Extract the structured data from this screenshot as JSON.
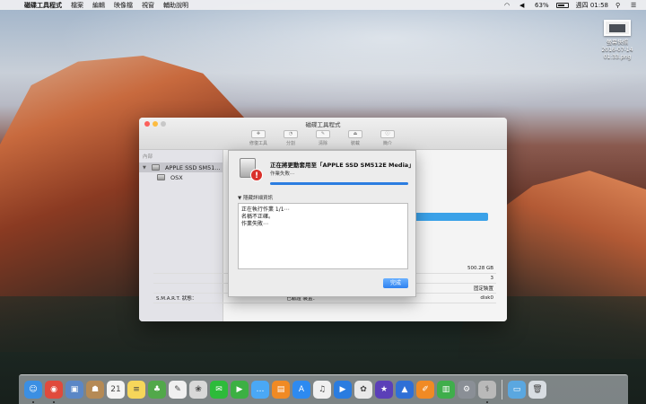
{
  "menubar": {
    "app_name": "磁碟工具程式",
    "items": [
      "檔案",
      "編輯",
      "映像檔",
      "視窗",
      "輔助說明"
    ],
    "battery": "63%",
    "clock": "週四 01:58"
  },
  "desktop_file": {
    "name_line1": "螢幕快照",
    "name_line2": "2016-07-14 01:33.png"
  },
  "window": {
    "title": "磁碟工具程式",
    "toolbar": [
      {
        "label": "修復工具",
        "icon": "stethoscope-icon",
        "glyph": "✚"
      },
      {
        "label": "分割",
        "icon": "partition-icon",
        "glyph": "◔"
      },
      {
        "label": "清除",
        "icon": "erase-icon",
        "glyph": "✎"
      },
      {
        "label": "裝載",
        "icon": "mount-icon",
        "glyph": "⏏"
      },
      {
        "label": "簡介",
        "icon": "info-icon",
        "glyph": "ⓘ"
      }
    ],
    "sidebar": {
      "section": "內部",
      "disk": "APPLE SSD SM51...",
      "volume": "OSX"
    },
    "info_rows": [
      {
        "left": "",
        "mid": "",
        "value": "500.28 GB"
      },
      {
        "left": "",
        "mid": "",
        "value": "3"
      },
      {
        "left": "",
        "mid": "",
        "value": "固定裝置"
      },
      {
        "left": "S.M.A.R.T. 狀態：",
        "mid": "已驗證  裝置：",
        "value": "disk0"
      }
    ]
  },
  "sheet": {
    "title": "正在將更動套用至「APPLE SSD SM512E Media」",
    "subtitle": "作業失敗⋯",
    "progress": 1.0,
    "details_label": "隱藏詳細資訊",
    "log": [
      "正在執行作業 1/1⋯",
      "名稱不正確。",
      "作業失敗⋯"
    ],
    "done_label": "完成"
  },
  "dock": [
    {
      "name": "finder-icon",
      "color": "#3b8fe3",
      "glyph": "☺",
      "running": true
    },
    {
      "name": "chrome-icon",
      "color": "#e04a3c",
      "glyph": "◉",
      "running": true
    },
    {
      "name": "preview-icon",
      "color": "#5b87c6",
      "glyph": "▣",
      "running": false
    },
    {
      "name": "contacts-icon",
      "color": "#b58a55",
      "glyph": "☗",
      "running": false
    },
    {
      "name": "calendar-icon",
      "color": "#f4f4f4",
      "glyph": "21",
      "running": false
    },
    {
      "name": "notes-icon",
      "color": "#f6d65a",
      "glyph": "≡",
      "running": false
    },
    {
      "name": "evernote-icon",
      "color": "#52a84a",
      "glyph": "♣",
      "running": false
    },
    {
      "name": "textedit-icon",
      "color": "#f0f0f0",
      "glyph": "✎",
      "running": false
    },
    {
      "name": "photos-icon",
      "color": "#d8d8d8",
      "glyph": "❀",
      "running": false
    },
    {
      "name": "line-icon",
      "color": "#2dbb3a",
      "glyph": "✉",
      "running": false
    },
    {
      "name": "facetime-icon",
      "color": "#3cb043",
      "glyph": "▶",
      "running": false
    },
    {
      "name": "messages-icon",
      "color": "#4aa8f5",
      "glyph": "…",
      "running": false
    },
    {
      "name": "ibooks-icon",
      "color": "#f08a24",
      "glyph": "▤",
      "running": false
    },
    {
      "name": "app-store-icon",
      "color": "#2d8af0",
      "glyph": "A",
      "running": false
    },
    {
      "name": "itunes-icon",
      "color": "#f0f0f0",
      "glyph": "♫",
      "running": false
    },
    {
      "name": "quicktime-icon",
      "color": "#2a7ce0",
      "glyph": "▶",
      "running": false
    },
    {
      "name": "picasa-icon",
      "color": "#e9e9e9",
      "glyph": "✿",
      "running": false
    },
    {
      "name": "imovie-icon",
      "color": "#5b3fb8",
      "glyph": "★",
      "running": false
    },
    {
      "name": "keynote-icon",
      "color": "#2f6fd6",
      "glyph": "▲",
      "running": false
    },
    {
      "name": "pages-icon",
      "color": "#f08a24",
      "glyph": "✐",
      "running": false
    },
    {
      "name": "numbers-icon",
      "color": "#3fae4b",
      "glyph": "▥",
      "running": false
    },
    {
      "name": "system-preferences-icon",
      "color": "#8a8f96",
      "glyph": "⚙",
      "running": false
    },
    {
      "name": "disk-utility-icon",
      "color": "#b9b9b9",
      "glyph": "⚕",
      "running": true
    }
  ],
  "dock_right": [
    {
      "name": "downloads-folder-icon",
      "color": "#5aa7e0",
      "glyph": "▭"
    },
    {
      "name": "trash-icon",
      "color": "#d8dde2",
      "glyph": "🗑"
    }
  ]
}
